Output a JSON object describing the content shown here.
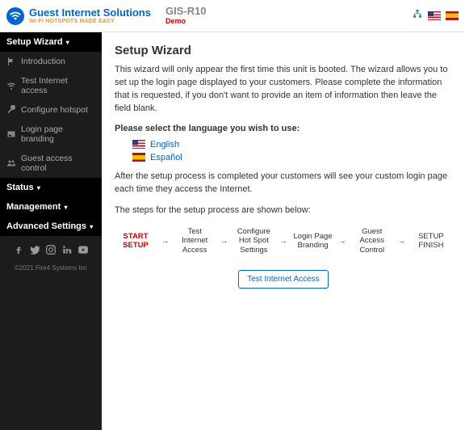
{
  "header": {
    "brand_main": "Guest Internet Solutions",
    "brand_sub": "WI-FI HOTSPOTS MADE EASY",
    "model": "GIS-R10",
    "demo": "Demo"
  },
  "sidebar": {
    "sections": {
      "setup_wizard": "Setup Wizard",
      "status": "Status",
      "management": "Management",
      "advanced": "Advanced Settings"
    },
    "items": {
      "introduction": "Introduction",
      "test_internet": "Test Internet access",
      "configure_hotspot": "Configure hotspot",
      "login_branding": "Login page branding",
      "guest_access": "Guest access control"
    },
    "copyright": "©2021 Fire4 Systems Inc"
  },
  "main": {
    "title": "Setup Wizard",
    "intro": "This wizard will only appear the first time this unit is booted. The wizard allows you to set up the login page displayed to your customers. Please complete the information that is requested, if you don't want to provide an item of information then leave the field blank.",
    "select_lang": "Please select the language you wish to use:",
    "languages": {
      "en": "English",
      "es": "Español"
    },
    "after_setup": "After the setup process is completed your customers will see your custom login page each time they access the Internet.",
    "steps_intro": "The steps for the setup process are shown below:",
    "flow": {
      "start": "START SETUP",
      "step1": "Test Internet Access",
      "step2": "Configure Hot Spot Settings",
      "step3": "Login Page Branding",
      "step4": "Guest Access Control",
      "finish": "SETUP FINISH"
    },
    "action_button": "Test Internet Access"
  }
}
